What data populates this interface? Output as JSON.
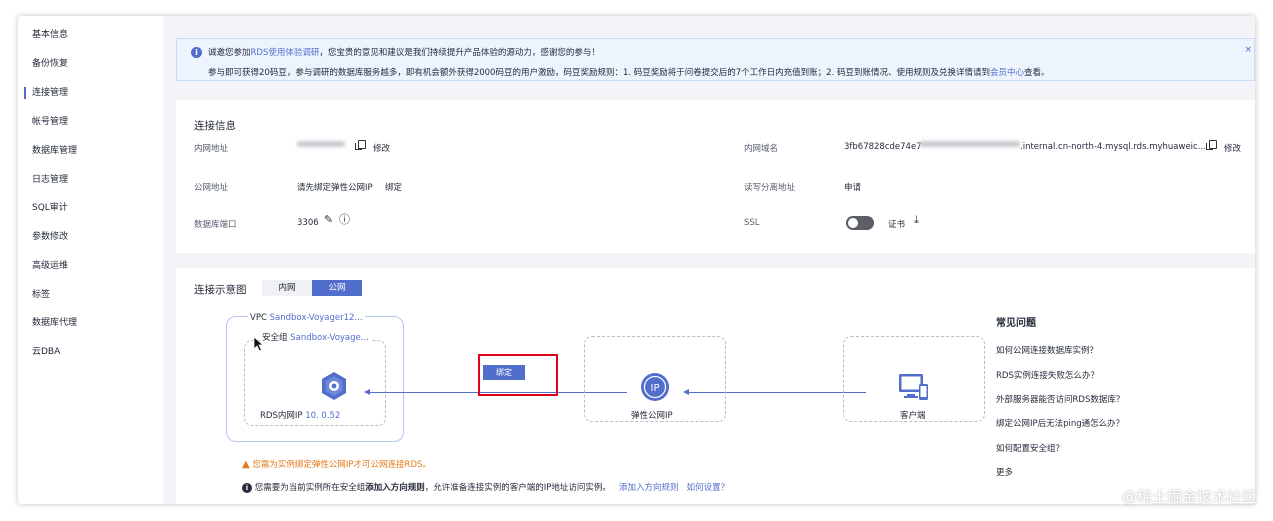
{
  "sidebar": {
    "items": [
      {
        "label": "基本信息"
      },
      {
        "label": "备份恢复"
      },
      {
        "label": "连接管理"
      },
      {
        "label": "帐号管理"
      },
      {
        "label": "数据库管理"
      },
      {
        "label": "日志管理"
      },
      {
        "label": "SQL审计"
      },
      {
        "label": "参数修改"
      },
      {
        "label": "高级运维"
      },
      {
        "label": "标签"
      },
      {
        "label": "数据库代理"
      },
      {
        "label": "云DBA"
      }
    ],
    "active_index": 2
  },
  "notice": {
    "line1_prefix": "诚邀您参加",
    "line1_link": "RDS使用体验调研",
    "line1_suffix": "，您宝贵的意见和建议是我们持续提升产品体验的源动力，感谢您的参与！",
    "line2_prefix": "参与即可获得20码豆，参与调研的数据库服务越多，即有机会额外获得2000码豆的用户激励，码豆奖励规则：1. 码豆奖励将于问卷提交后的7个工作日内充值到账；2. 码豆到账情况、使用规则及兑换详情请到",
    "line2_link": "会员中心",
    "line2_suffix": "查看。",
    "close": "×"
  },
  "conn_info": {
    "title": "连接信息",
    "private_addr_label": "内网地址",
    "modify": "修改",
    "public_addr_label": "公网地址",
    "public_addr_value": "请先绑定弹性公网IP",
    "bind": "绑定",
    "port_label": "数据库端口",
    "port_value": "3306",
    "private_domain_label": "内网域名",
    "private_domain_prefix": "3fb67828cde74e7",
    "private_domain_suffix": ".internal.cn-north-4.mysql.rds.myhuaweic...",
    "rw_addr_label": "读写分离地址",
    "apply": "申请",
    "ssl_label": "SSL",
    "cert": "证书"
  },
  "diagram": {
    "title": "连接示意图",
    "tabs": [
      "内网",
      "公网"
    ],
    "vpc_label": "VPC",
    "vpc_value": "Sandbox-Voyager12...",
    "sg_label": "安全组",
    "sg_value": "Sandbox-Voyage...",
    "rds_label": "RDS内网IP",
    "rds_ip_visible": "10.",
    "rds_ip_tail": "0.52",
    "bind_button": "绑定",
    "eip_label": "弹性公网IP",
    "eip_icon_text": "IP",
    "client_label": "客户端",
    "warn1": "您需为实例绑定弹性公网IP才可公网连接RDS。",
    "warn2_prefix": "您需要为当前实例所在安全组",
    "warn2_bold": "添加入方向规则",
    "warn2_suffix": "，允许准备连接实例的客户端的IP地址访问实例。",
    "warn2_link1": "添加入方向规则",
    "warn2_link2": "如何设置？"
  },
  "faq": {
    "title": "常见问题",
    "items": [
      "如何公网连接数据库实例？",
      "RDS实例连接失败怎么办？",
      "外部服务器能否访问RDS数据库？",
      "绑定公网IP后无法ping通怎么办？",
      "如何配置安全组？"
    ],
    "more": "更多"
  },
  "watermark": "@稀土掘金技术社区",
  "colors": {
    "accent": "#526ecc",
    "warning": "#e37a1b",
    "highlight_border": "#e0001b"
  }
}
